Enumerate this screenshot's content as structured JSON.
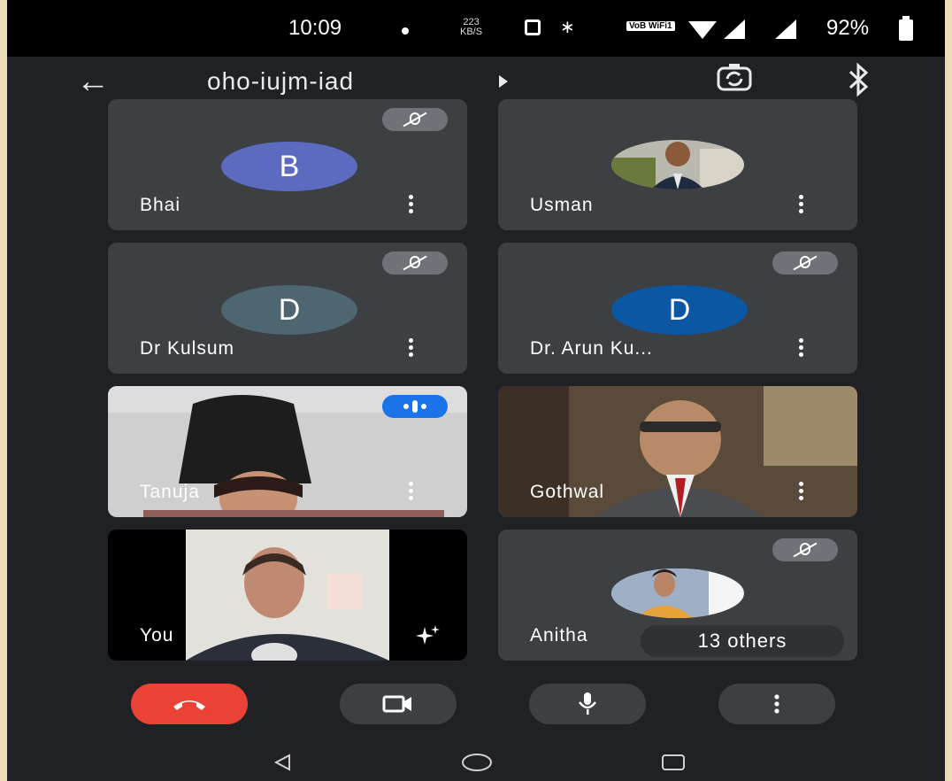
{
  "status_bar": {
    "time": "10:09",
    "net_speed_value": "223",
    "net_speed_unit": "KB/S",
    "volte_label": "VoB WiFi1",
    "battery": "92%"
  },
  "header": {
    "meeting_code": "oho-iujm-iad"
  },
  "participants": [
    {
      "name": "Bhai",
      "initial": "B",
      "avatar_color": "#5c6bc0",
      "muted": true
    },
    {
      "name": "Usman",
      "initial": "",
      "muted": false
    },
    {
      "name": "Dr Kulsum",
      "initial": "D",
      "avatar_color": "#4e6670",
      "muted": true
    },
    {
      "name": "Dr. Arun Ku...",
      "initial": "D",
      "avatar_color": "#0b57a4",
      "muted": true
    },
    {
      "name": "Tanuja",
      "initial": "",
      "speaking": true
    },
    {
      "name": "Gothwal",
      "initial": ""
    },
    {
      "name": "You",
      "initial": ""
    },
    {
      "name": "Anitha",
      "initial": "",
      "muted": true
    }
  ],
  "others_label": "13 others",
  "colors": {
    "background": "#202124",
    "tile": "#3c4043",
    "end_call": "#ea4335",
    "speaking": "#1a73e8"
  },
  "icons": {
    "back": "arrow-left-icon",
    "switch_camera": "camera-switch-icon",
    "bluetooth": "bluetooth-icon",
    "end_call": "phone-hangup-icon",
    "camera": "video-camera-icon",
    "mic": "microphone-icon",
    "more": "more-vertical-icon",
    "effects": "sparkle-icon"
  }
}
